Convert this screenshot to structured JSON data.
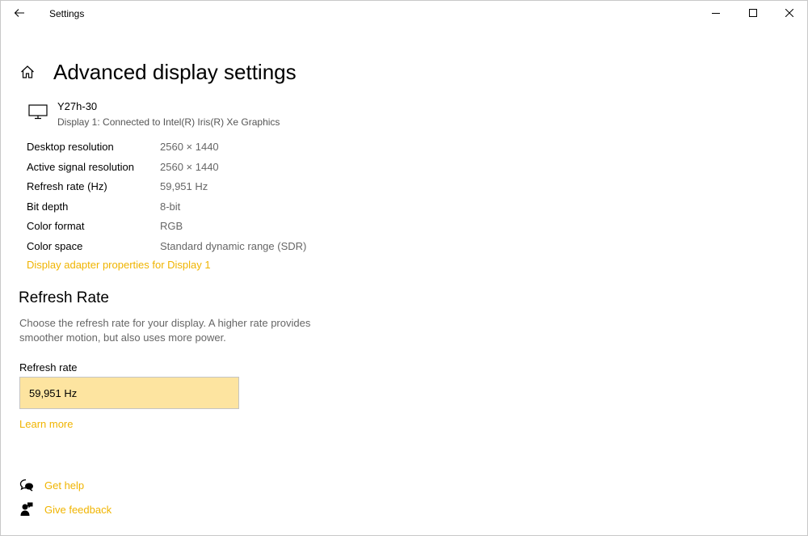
{
  "window": {
    "title": "Settings"
  },
  "page": {
    "title": "Advanced display settings"
  },
  "display": {
    "name": "Y27h-30",
    "description": "Display 1: Connected to Intel(R) Iris(R) Xe Graphics"
  },
  "info_rows": [
    {
      "label": "Desktop resolution",
      "value": "2560 × 1440"
    },
    {
      "label": "Active signal resolution",
      "value": "2560 × 1440"
    },
    {
      "label": "Refresh rate (Hz)",
      "value": "59,951 Hz"
    },
    {
      "label": "Bit depth",
      "value": "8-bit"
    },
    {
      "label": "Color format",
      "value": "RGB"
    },
    {
      "label": "Color space",
      "value": "Standard dynamic range (SDR)"
    }
  ],
  "adapter_link": "Display adapter properties for Display 1",
  "refresh_section": {
    "title": "Refresh Rate",
    "description": "Choose the refresh rate for your display. A higher rate provides smoother motion, but also uses more power.",
    "field_label": "Refresh rate",
    "selected_value": "59,951 Hz",
    "learn_more": "Learn more"
  },
  "help": {
    "get_help": "Get help",
    "give_feedback": "Give feedback"
  },
  "colors": {
    "accent": "#f0b400",
    "dropdown_bg": "#fde4a0",
    "secondary_text": "#666666"
  },
  "icons": [
    "back-arrow-icon",
    "minimize-icon",
    "maximize-icon",
    "close-icon",
    "home-icon",
    "monitor-icon",
    "get-help-icon",
    "feedback-icon"
  ]
}
